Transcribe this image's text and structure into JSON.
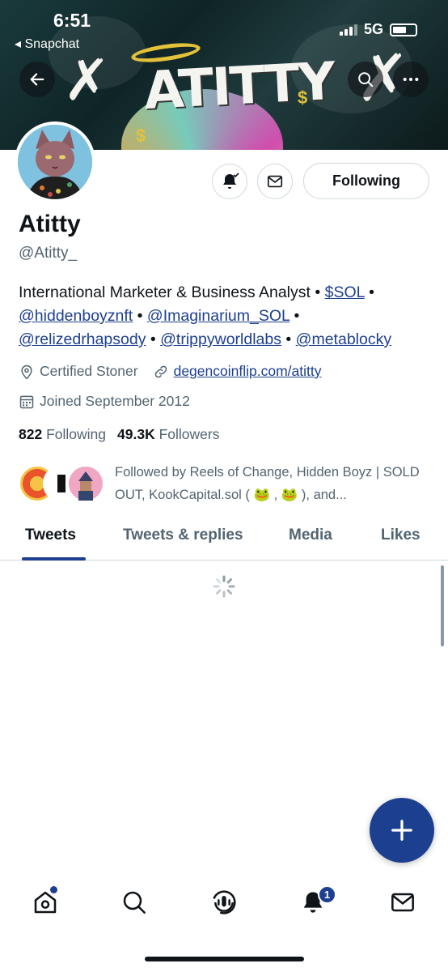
{
  "status_bar": {
    "time": "6:51",
    "back_app": "◂ Snapchat",
    "network": "5G"
  },
  "banner": {
    "art_text": "ATITTY"
  },
  "profile": {
    "name": "Atitty",
    "handle": "@Atitty_",
    "follow_button": "Following",
    "bio": {
      "text_1": "International Marketer & Business Analyst • ",
      "link_sol": "$SOL",
      "sep": " • ",
      "link_hidden": "@hiddenboyznft",
      "link_imag": "@Imaginarium_SOL",
      "link_relized": "@relizedrhapsody",
      "link_trippy": "@trippyworldlabs",
      "link_meta": "@metablocky"
    },
    "location": "Certified Stoner",
    "website": "degencoinflip.com/atitty",
    "joined": "Joined September 2012",
    "following_count": "822",
    "following_label": "Following",
    "followers_count": "49.3K",
    "followers_label": "Followers",
    "followed_by": "Followed by Reels of Change, Hidden Boyz | SOLD OUT, KookCapital.sol ( 🐸 , 🐸 ), and..."
  },
  "tabs": [
    {
      "label": "Tweets"
    },
    {
      "label": "Tweets & replies"
    },
    {
      "label": "Media"
    },
    {
      "label": "Likes"
    }
  ],
  "notifications_badge": "1",
  "colors": {
    "accent": "#1d3f8f",
    "secondary_text": "#536471",
    "border": "#cfd9de"
  }
}
